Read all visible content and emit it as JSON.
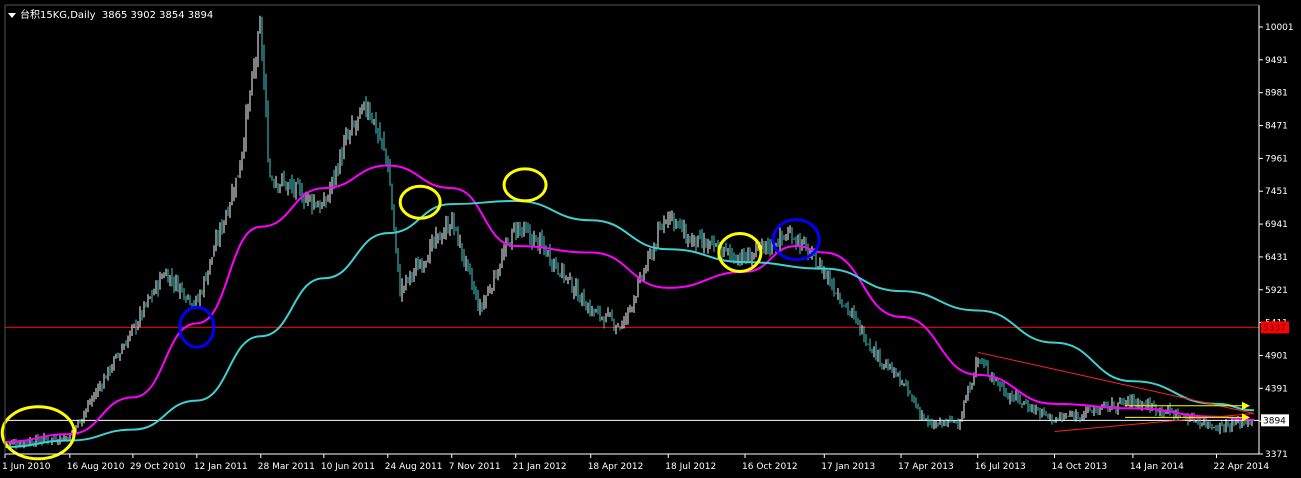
{
  "header": {
    "symbol": "台积15KG,Daily",
    "ohlc": "3865 3902 3854 3894"
  },
  "chart_data": {
    "type": "candlestick",
    "symbol": "台积15KG",
    "timeframe": "Daily",
    "ohlc_last": {
      "open": 3865,
      "high": 3902,
      "low": 3854,
      "close": 3894
    },
    "y_ticks": [
      10001,
      9491,
      8981,
      8471,
      7961,
      7451,
      6941,
      6431,
      5921,
      5411,
      4901,
      4391,
      3881,
      3371
    ],
    "ylim": [
      3371,
      10001
    ],
    "x_ticks": [
      "1 Jun 2010",
      "16 Aug 2010",
      "29 Oct 2010",
      "12 Jan 2011",
      "28 Mar 2011",
      "10 Jun 2011",
      "24 Aug 2011",
      "7 Nov 2011",
      "21 Jan 2012",
      "18 Apr 2012",
      "18 Jul 2012",
      "16 Oct 2012",
      "17 Jan 2013",
      "17 Apr 2013",
      "16 Jul 2013",
      "14 Oct 2013",
      "14 Jan 2014",
      "22 Apr 2014"
    ],
    "horizontal_lines": [
      {
        "value": 5337,
        "color": "#ff0000",
        "label": "5337"
      },
      {
        "value": 3894,
        "color": "#ffffff",
        "label": "3894"
      }
    ],
    "price_anchors": [
      [
        "1 Jun 2010",
        3530
      ],
      [
        "16 Aug 2010",
        3640
      ],
      [
        "29 Oct 2010",
        5300
      ],
      [
        "5 Dec 2010",
        6200
      ],
      [
        "12 Jan 2011",
        5700
      ],
      [
        "1 Mar 2011",
        7700
      ],
      [
        "28 Mar 2011",
        10000
      ],
      [
        "7 Apr 2011",
        7700
      ],
      [
        "10 Jun 2011",
        7200
      ],
      [
        "5 Jul 2011",
        8200
      ],
      [
        "1 Aug 2011",
        8800
      ],
      [
        "24 Aug 2011",
        7900
      ],
      [
        "7 Sep 2011",
        5900
      ],
      [
        "7 Nov 2011",
        7000
      ],
      [
        "10 Dec 2011",
        5600
      ],
      [
        "21 Jan 2012",
        6900
      ],
      [
        "21 Feb 2012",
        6600
      ],
      [
        "18 Apr 2012",
        5600
      ],
      [
        "25 May 2012",
        5350
      ],
      [
        "18 Jul 2012",
        7150
      ],
      [
        "10 Aug 2012",
        6700
      ],
      [
        "16 Oct 2012",
        6400
      ],
      [
        "10 Dec 2012",
        6800
      ],
      [
        "17 Jan 2013",
        6200
      ],
      [
        "10 Feb 2013",
        5700
      ],
      [
        "20 Mar 2013",
        4900
      ],
      [
        "17 Apr 2013",
        4500
      ],
      [
        "20 May 2013",
        3800
      ],
      [
        "25 Jun 2013",
        3900
      ],
      [
        "16 Jul 2013",
        4850
      ],
      [
        "20 Aug 2013",
        4300
      ],
      [
        "14 Oct 2013",
        3900
      ],
      [
        "14 Jan 2014",
        4200
      ],
      [
        "22 Apr 2014",
        3800
      ],
      [
        "5 Jun 2014",
        3894
      ]
    ],
    "series": [
      {
        "name": "",
        "color": "#ff00ff",
        "points": [
          [
            "1 Jun 2010",
            3560
          ],
          [
            "16 Aug 2010",
            3680
          ],
          [
            "29 Oct 2010",
            4250
          ],
          [
            "12 Jan 2011",
            5400
          ],
          [
            "28 Mar 2011",
            6900
          ],
          [
            "10 Jun 2011",
            7500
          ],
          [
            "24 Aug 2011",
            7850
          ],
          [
            "7 Nov 2011",
            7500
          ],
          [
            "21 Jan 2012",
            6600
          ],
          [
            "18 Apr 2012",
            6500
          ],
          [
            "18 Jul 2012",
            5950
          ],
          [
            "16 Oct 2012",
            6200
          ],
          [
            "15 Dec 2012",
            6600
          ],
          [
            "17 Jan 2013",
            6500
          ],
          [
            "17 Apr 2013",
            5500
          ],
          [
            "16 Jul 2013",
            4600
          ],
          [
            "14 Oct 2013",
            4150
          ],
          [
            "14 Jan 2014",
            4080
          ],
          [
            "22 Apr 2014",
            3950
          ],
          [
            "5 Jun 2014",
            3900
          ]
        ]
      },
      {
        "name": "",
        "color": "#40d0d0",
        "points": [
          [
            "1 Jun 2010",
            3480
          ],
          [
            "16 Aug 2010",
            3580
          ],
          [
            "29 Oct 2010",
            3750
          ],
          [
            "12 Jan 2011",
            4200
          ],
          [
            "28 Mar 2011",
            5200
          ],
          [
            "10 Jun 2011",
            6100
          ],
          [
            "24 Aug 2011",
            6800
          ],
          [
            "7 Nov 2011",
            7250
          ],
          [
            "21 Jan 2012",
            7300
          ],
          [
            "18 Apr 2012",
            7000
          ],
          [
            "18 Jul 2012",
            6550
          ],
          [
            "16 Oct 2012",
            6350
          ],
          [
            "17 Jan 2013",
            6250
          ],
          [
            "17 Apr 2013",
            5900
          ],
          [
            "16 Jul 2013",
            5600
          ],
          [
            "14 Oct 2013",
            5100
          ],
          [
            "14 Jan 2014",
            4500
          ],
          [
            "22 Apr 2014",
            4150
          ],
          [
            "5 Jun 2014",
            4050
          ]
        ]
      }
    ],
    "trend_lines": [
      {
        "color": "#ff2020",
        "from": [
          "16 Jul 2013",
          4950
        ],
        "to": [
          "5 Jun 2014",
          4000
        ]
      },
      {
        "color": "#ff2020",
        "from": [
          "14 Oct 2013",
          3720
        ],
        "to": [
          "5 Jun 2014",
          4000
        ]
      }
    ],
    "arrows": [
      {
        "color": "#ffff00",
        "value": 4120
      },
      {
        "color": "#ffff00",
        "value": 3940
      }
    ],
    "annotations": [
      {
        "shape": "ellipse",
        "color": "#ffff00",
        "center": [
          "10 Jul 2010",
          3700
        ]
      },
      {
        "shape": "ellipse",
        "color": "#0000ff",
        "center": [
          "12 Jan 2011",
          5340
        ]
      },
      {
        "shape": "ellipse",
        "color": "#ffff00",
        "center": [
          "1 Oct 2011",
          7280
        ]
      },
      {
        "shape": "ellipse",
        "color": "#ffff00",
        "center": [
          "1 Feb 2012",
          7550
        ]
      },
      {
        "shape": "ellipse",
        "color": "#ffff00",
        "center": [
          "10 Oct 2012",
          6500
        ]
      },
      {
        "shape": "ellipse",
        "color": "#0000ff",
        "center": [
          "15 Dec 2012",
          6700
        ]
      }
    ],
    "grid": false,
    "colors": {
      "background": "#000000",
      "bull": "#ffffff",
      "bear": "#40d0d0",
      "axis": "#ffffff"
    }
  }
}
